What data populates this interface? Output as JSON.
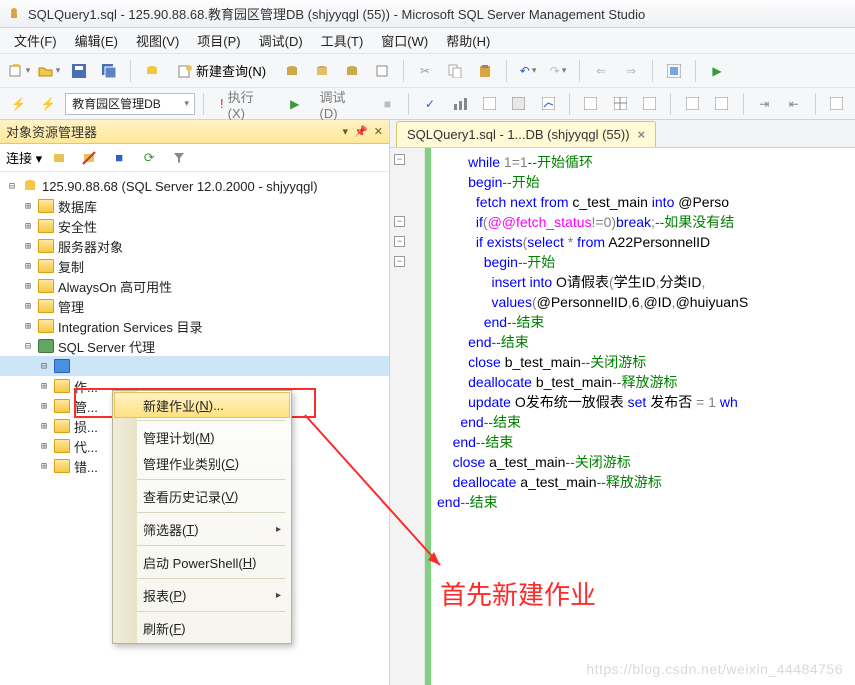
{
  "title": "SQLQuery1.sql - 125.90.88.68.教育园区管理DB (shjyyqgl (55)) - Microsoft SQL Server Management Studio",
  "menubar": [
    "文件(F)",
    "编辑(E)",
    "视图(V)",
    "项目(P)",
    "调试(D)",
    "工具(T)",
    "窗口(W)",
    "帮助(H)"
  ],
  "new_query_label": "新建查询(N)",
  "db_combo": "教育园区管理DB",
  "execute_label": "执行(X)",
  "debug_label": "调试(D)",
  "object_explorer": {
    "title": "对象资源管理器",
    "connect_label": "连接 ▾",
    "server": "125.90.88.68 (SQL Server 12.0.2000 - shjyyqgl)",
    "folders": [
      "数据库",
      "安全性",
      "服务器对象",
      "复制",
      "AlwaysOn 高可用性",
      "管理",
      "Integration Services 目录"
    ],
    "agent": "SQL Server 代理",
    "agent_children_prefix": [
      "作",
      "管",
      "损",
      "代",
      "错"
    ]
  },
  "context_menu": {
    "items": [
      {
        "label": "新建作业(N)...",
        "hot": "N",
        "highlight": true
      },
      {
        "sep": true
      },
      {
        "label": "管理计划(M)",
        "hot": "M"
      },
      {
        "label": "管理作业类别(C)",
        "hot": "C"
      },
      {
        "sep": true
      },
      {
        "label": "查看历史记录(V)",
        "hot": "V"
      },
      {
        "sep": true
      },
      {
        "label": "筛选器(T)",
        "hot": "T",
        "submenu": true
      },
      {
        "sep": true
      },
      {
        "label": "启动 PowerShell(H)",
        "hot": "H"
      },
      {
        "sep": true
      },
      {
        "label": "报表(P)",
        "hot": "P",
        "submenu": true
      },
      {
        "sep": true
      },
      {
        "label": "刷新(F)",
        "hot": "F"
      }
    ]
  },
  "tab_label": "SQLQuery1.sql - 1...DB (shjyyqgl (55))",
  "annotation": "首先新建作业",
  "watermark": "https://blog.csdn.net/weixin_44484756",
  "code_lines": [
    {
      "ind": 4,
      "tokens": [
        {
          "c": "kb",
          "t": "while"
        },
        {
          "c": "kg",
          "t": " 1=1"
        },
        {
          "c": "kgrn",
          "t": "--开始循环"
        }
      ]
    },
    {
      "ind": 4,
      "tokens": [
        {
          "c": "kb",
          "t": "begin"
        },
        {
          "c": "kgrn",
          "t": "--开始"
        }
      ]
    },
    {
      "ind": 5,
      "tokens": [
        {
          "c": "kb",
          "t": "fetch"
        },
        {
          "c": "kb",
          "t": " next from"
        },
        {
          "c": "kblk",
          "t": " c_test_main "
        },
        {
          "c": "kb",
          "t": "into"
        },
        {
          "c": "kblk",
          "t": " @Perso"
        }
      ]
    },
    {
      "ind": 5,
      "tokens": [
        {
          "c": "kb",
          "t": "if"
        },
        {
          "c": "kg",
          "t": "("
        },
        {
          "c": "kmag",
          "t": "@@fetch_status"
        },
        {
          "c": "kg",
          "t": "!=0)"
        },
        {
          "c": "kb",
          "t": "break"
        },
        {
          "c": "kg",
          "t": ";"
        },
        {
          "c": "kgrn",
          "t": "--如果没有结"
        }
      ]
    },
    {
      "ind": 5,
      "tokens": [
        {
          "c": "kb",
          "t": "if"
        },
        {
          "c": "kg",
          "t": " "
        },
        {
          "c": "kb",
          "t": "exists"
        },
        {
          "c": "kg",
          "t": "("
        },
        {
          "c": "kb",
          "t": "select"
        },
        {
          "c": "kg",
          "t": " * "
        },
        {
          "c": "kb",
          "t": "from"
        },
        {
          "c": "kblk",
          "t": " A22PersonnelID"
        }
      ]
    },
    {
      "ind": 6,
      "tokens": [
        {
          "c": "kb",
          "t": "begin"
        },
        {
          "c": "kgrn",
          "t": "--开始"
        }
      ]
    },
    {
      "ind": 7,
      "tokens": [
        {
          "c": "kb",
          "t": "insert"
        },
        {
          "c": "kb",
          "t": " into"
        },
        {
          "c": "kblk",
          "t": " O请假表"
        },
        {
          "c": "kg",
          "t": "("
        },
        {
          "c": "kblk",
          "t": "学生ID"
        },
        {
          "c": "kg",
          "t": ","
        },
        {
          "c": "kblk",
          "t": "分类ID"
        },
        {
          "c": "kg",
          "t": ","
        }
      ]
    },
    {
      "ind": 7,
      "tokens": [
        {
          "c": "kb",
          "t": "values"
        },
        {
          "c": "kg",
          "t": "("
        },
        {
          "c": "kblk",
          "t": "@PersonnelID"
        },
        {
          "c": "kg",
          "t": ","
        },
        {
          "c": "kblk",
          "t": "6"
        },
        {
          "c": "kg",
          "t": ","
        },
        {
          "c": "kblk",
          "t": "@ID"
        },
        {
          "c": "kg",
          "t": ","
        },
        {
          "c": "kblk",
          "t": "@huiyuanS"
        }
      ]
    },
    {
      "ind": 6,
      "tokens": [
        {
          "c": "kb",
          "t": "end"
        },
        {
          "c": "kgrn",
          "t": "--结束"
        }
      ]
    },
    {
      "ind": 4,
      "tokens": [
        {
          "c": "kb",
          "t": "end"
        },
        {
          "c": "kgrn",
          "t": "--结束"
        }
      ]
    },
    {
      "ind": 4,
      "tokens": [
        {
          "c": "kb",
          "t": "close"
        },
        {
          "c": "kblk",
          "t": " b_test_main"
        },
        {
          "c": "kgrn",
          "t": "--关闭游标"
        }
      ]
    },
    {
      "ind": 4,
      "tokens": [
        {
          "c": "kb",
          "t": "deallocate"
        },
        {
          "c": "kblk",
          "t": " b_test_main"
        },
        {
          "c": "kgrn",
          "t": "--释放游标"
        }
      ]
    },
    {
      "ind": 4,
      "tokens": [
        {
          "c": "kb",
          "t": "update"
        },
        {
          "c": "kblk",
          "t": " O发布统一放假表 "
        },
        {
          "c": "kb",
          "t": "set"
        },
        {
          "c": "kblk",
          "t": " 发布否 "
        },
        {
          "c": "kg",
          "t": "= 1 "
        },
        {
          "c": "kb",
          "t": "wh"
        }
      ]
    },
    {
      "ind": 3,
      "tokens": [
        {
          "c": "kb",
          "t": "end"
        },
        {
          "c": "kgrn",
          "t": "--结束"
        }
      ]
    },
    {
      "ind": 2,
      "tokens": [
        {
          "c": "kb",
          "t": "end"
        },
        {
          "c": "kgrn",
          "t": "--结束"
        }
      ]
    },
    {
      "ind": 2,
      "tokens": [
        {
          "c": "kb",
          "t": "close"
        },
        {
          "c": "kblk",
          "t": " a_test_main"
        },
        {
          "c": "kgrn",
          "t": "--关闭游标"
        }
      ]
    },
    {
      "ind": 2,
      "tokens": [
        {
          "c": "kb",
          "t": "deallocate"
        },
        {
          "c": "kblk",
          "t": " a_test_main"
        },
        {
          "c": "kgrn",
          "t": "--释放游标"
        }
      ]
    },
    {
      "ind": 0,
      "tokens": [
        {
          "c": "kb",
          "t": "end"
        },
        {
          "c": "kgrn",
          "t": "--结束"
        }
      ]
    }
  ]
}
